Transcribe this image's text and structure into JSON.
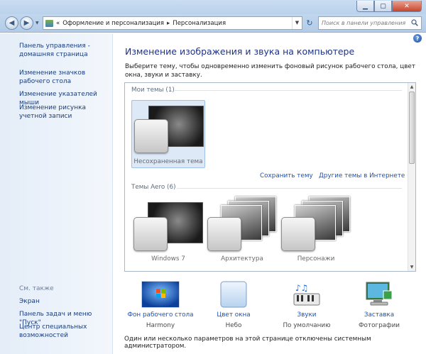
{
  "breadcrumb": {
    "prefix": "«",
    "parent": "Оформление и персонализация",
    "separator": "▸",
    "current": "Персонализация"
  },
  "search": {
    "placeholder": "Поиск в панели управления"
  },
  "help_label": "?",
  "sidebar": {
    "home_link": "Панель управления - домашняя страница",
    "tasks": [
      "Изменение значков рабочего стола",
      "Изменение указателей мыши",
      "Изменение рисунка учетной записи"
    ],
    "see_also_title": "См. также",
    "see_also": [
      "Экран",
      "Панель задач и меню \"Пуск\"",
      "Центр специальных возможностей"
    ]
  },
  "main": {
    "heading": "Изменение изображения и звука на компьютере",
    "description": "Выберите тему, чтобы одновременно изменить фоновый рисунок рабочего стола, цвет окна, звуки и заставку.",
    "my_themes_group": "Мои темы (1)",
    "unsaved_theme": "Несохраненная тема",
    "save_theme": "Сохранить тему",
    "online_themes": "Другие темы в Интернете",
    "aero_group": "Темы Aero (6)",
    "aero_themes": [
      "Windows 7",
      "Архитектура",
      "Персонажи"
    ]
  },
  "bottom": {
    "items": [
      {
        "label": "Фон рабочего стола",
        "value": "Harmony"
      },
      {
        "label": "Цвет окна",
        "value": "Небо"
      },
      {
        "label": "Звуки",
        "value": "По умолчанию"
      },
      {
        "label": "Заставка",
        "value": "Фотографии"
      }
    ],
    "note": "Один или несколько параметров на этой странице отключены системным администратором."
  },
  "colors": {
    "link": "#1a52b8",
    "heading": "#1e3287",
    "sidebar_bg": "#e4edf8"
  }
}
